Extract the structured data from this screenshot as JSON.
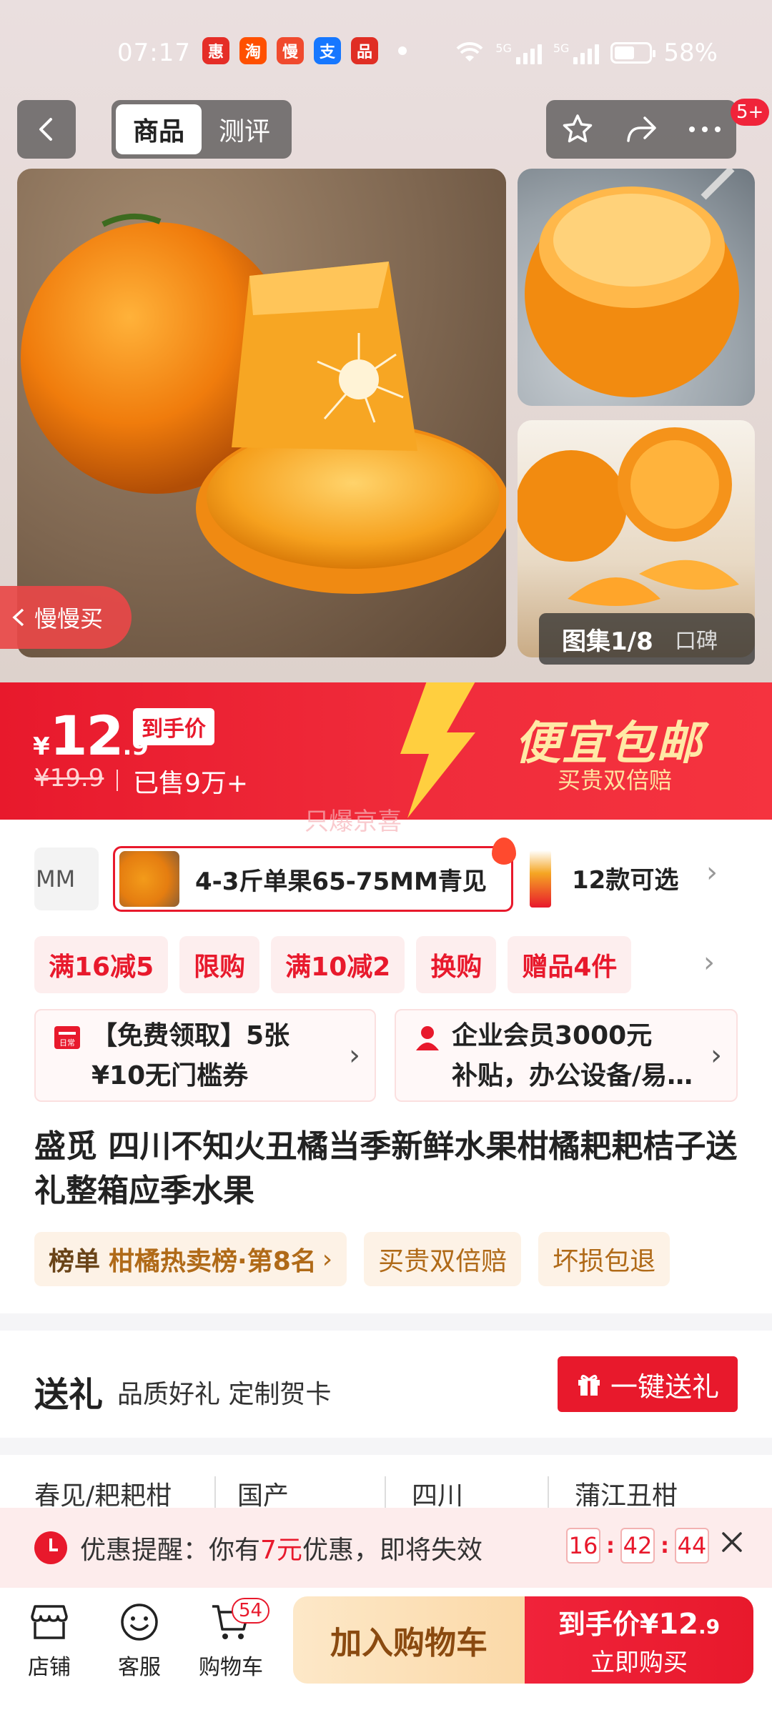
{
  "status_bar": {
    "time": "07:17",
    "battery": "58%",
    "battery_level": 0.58,
    "apps": [
      {
        "icon": "app-icon-1",
        "glyph": "惠",
        "color": "#e52d27"
      },
      {
        "icon": "taobao-icon",
        "glyph": "淘",
        "color": "#ff5000"
      },
      {
        "icon": "manman-icon",
        "glyph": "慢",
        "color": "#f04a2e"
      },
      {
        "icon": "alipay-icon",
        "glyph": "支",
        "color": "#1677ff"
      },
      {
        "icon": "pdd-icon",
        "glyph": "品",
        "color": "#e02e24"
      }
    ],
    "network": [
      "5G",
      "5G"
    ]
  },
  "top_nav": {
    "tabs": [
      {
        "label": "商品"
      },
      {
        "label": "测评"
      }
    ],
    "more_badge": "5+"
  },
  "gallery": {
    "slow_buy": "慢慢买",
    "counter": "图集1/8",
    "reviews": "口碑"
  },
  "price": {
    "currency": "¥",
    "integer": "12",
    "decimal": ".9",
    "tag": "到手价",
    "original": "¥19.9",
    "sold": "已售9万+",
    "slogan": "便宜包邮",
    "slogan_sub": "买贵双倍赔",
    "watermark": "只爆京喜"
  },
  "variants": {
    "prev": "MM",
    "selected": "4-3斤单果65-75MM青见",
    "count": "12款可选"
  },
  "promos": [
    "满16减5",
    "限购",
    "满10减2",
    "换购",
    "赠品4件"
  ],
  "coupons": [
    {
      "line1": "【免费领取】5张",
      "line2": "¥10无门槛券"
    },
    {
      "line1": "企业会员3000元",
      "line2": "补贴，办公设备/易…"
    }
  ],
  "product": {
    "title": "盛觅 四川不知火丑橘当季新鲜水果柑橘耙耙桔子送礼整箱应季水果"
  },
  "badges": {
    "rank_label": "榜单",
    "rank_value": "柑橘热卖榜·第8名",
    "b2": "买贵双倍赔",
    "b3": "坏损包退"
  },
  "gift": {
    "title": "送礼",
    "subtitle": "品质好礼 定制贺卡",
    "button": "一键送礼"
  },
  "attributes": [
    "春见/耙耙柑",
    "国产",
    "四川",
    "蒲江丑柑"
  ],
  "reminder": {
    "label": "优惠提醒：",
    "text_pre": "你有",
    "amount": "7元",
    "text_post": "优惠，即将失效",
    "timer": [
      "16",
      "42",
      "44"
    ]
  },
  "bottom_bar": {
    "store": "店铺",
    "service": "客服",
    "cart": "购物车",
    "cart_count": "54",
    "add_cart": "加入购物车",
    "buy_label": "到手价",
    "buy_currency": "¥",
    "buy_int": "12",
    "buy_dec": ".9",
    "buy_now": "立即购买"
  },
  "colors": {
    "accent": "#e8192c",
    "slogan": "#ffe9a6",
    "badge_text": "#b06a18"
  }
}
